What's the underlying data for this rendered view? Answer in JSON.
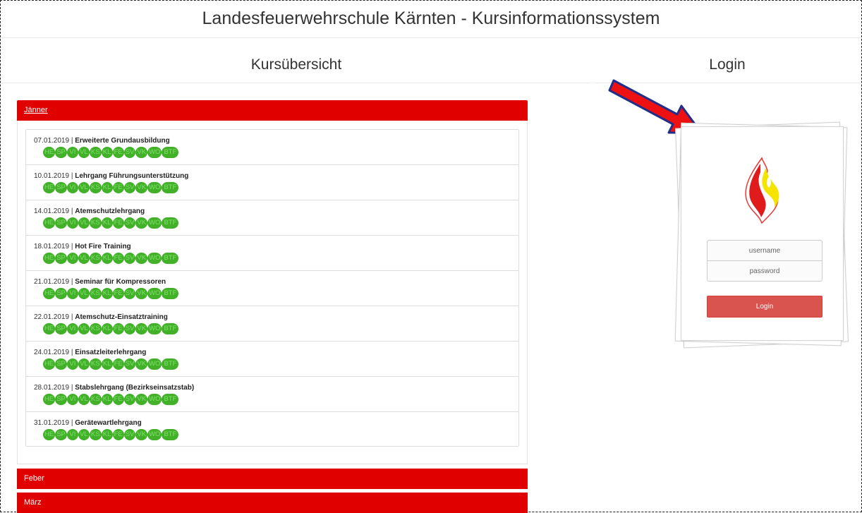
{
  "header": {
    "title": "Landesfeuerwehrschule Kärnten - Kursinformationssystem"
  },
  "overview": {
    "title": "Kursübersicht"
  },
  "login": {
    "title": "Login",
    "username_placeholder": "username",
    "password_placeholder": "password",
    "button_label": "Login"
  },
  "badge_labels": [
    "HE",
    "SP",
    "VI",
    "VL",
    "KS",
    "KL",
    "FE",
    "SV",
    "VK",
    "WO",
    "BTF"
  ],
  "months": [
    {
      "name": "Jänner",
      "courses": [
        {
          "date": "07.01.2019 |",
          "name": "Erweiterte Grundausbildung"
        },
        {
          "date": "10.01.2019 |",
          "name": "Lehrgang Führungsunterstützung"
        },
        {
          "date": "14.01.2019 |",
          "name": "Atemschutzlehrgang"
        },
        {
          "date": "18.01.2019 |",
          "name": "Hot Fire Training"
        },
        {
          "date": "21.01.2019 |",
          "name": "Seminar für Kompressoren"
        },
        {
          "date": "22.01.2019 |",
          "name": "Atemschutz-Einsatztraining"
        },
        {
          "date": "24.01.2019 |",
          "name": "Einsatzleiterlehrgang"
        },
        {
          "date": "28.01.2019 |",
          "name": "Stabslehrgang (Bezirkseinsatzstab)"
        },
        {
          "date": "31.01.2019 |",
          "name": "Gerätewartlehrgang"
        }
      ]
    },
    {
      "name": "Feber"
    },
    {
      "name": "März"
    }
  ],
  "colors": {
    "accent": "#e00000",
    "badge": "#43b02a",
    "login_button": "#d9534f"
  }
}
